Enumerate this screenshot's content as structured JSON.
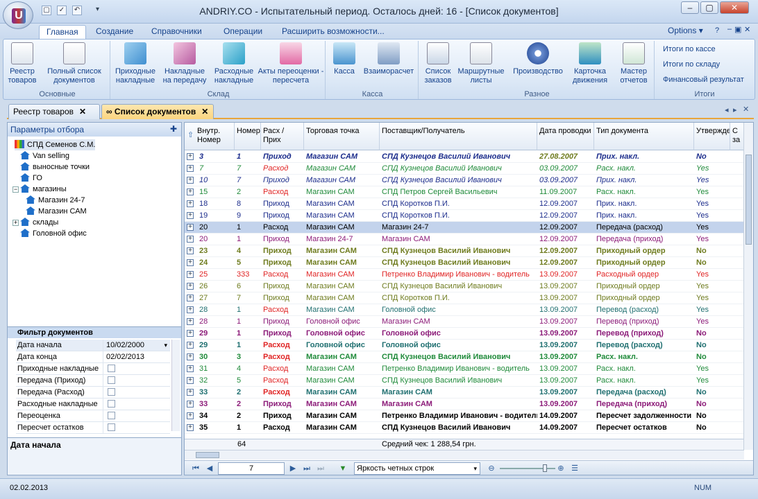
{
  "window": {
    "title": "ANDRIY.CO - Испытательный период. Осталось дней: 16 - [Список документов]"
  },
  "ribbon_tabs": [
    "Главная",
    "Создание",
    "Справочники",
    "Операции",
    "Расширить возможности..."
  ],
  "options_label": "Options",
  "groups": {
    "osnovnye": {
      "label": "Основные",
      "buttons": [
        "Реестр товаров",
        "Полный список документов"
      ]
    },
    "sklad": {
      "label": "Склад",
      "buttons": [
        "Приходные накладные",
        "Накладные на передачу",
        "Расходные накладные",
        "Акты переоценки - пересчета"
      ]
    },
    "kassa": {
      "label": "Касса",
      "buttons": [
        "Касса",
        "Взаиморасчет"
      ]
    },
    "raznoe": {
      "label": "Разное",
      "buttons": [
        "Список заказов",
        "Маршрутные листы",
        "Производство",
        "Карточка движения",
        "Мастер отчетов"
      ]
    },
    "itogi": {
      "label": "Итоги",
      "buttons": [
        "Итоги по кассе",
        "Итоги по складу",
        "Финансовый результат"
      ]
    }
  },
  "doc_tabs": [
    "Реестр товаров",
    "Список документов"
  ],
  "params": {
    "title": "Параметры отбора",
    "tree": [
      "СПД Семенов С.М.",
      "Van selling",
      "выносные точки",
      "ГО",
      "магазины",
      "Магазин 24-7",
      "Магазин САМ",
      "склады",
      "Головной офис"
    ]
  },
  "filter": {
    "title": "Фильтр документов",
    "rows": [
      {
        "label": "Дата начала",
        "value": "10/02/2000"
      },
      {
        "label": "Дата конца",
        "value": "02/02/2013"
      },
      {
        "label": "Приходные накладные",
        "value": ""
      },
      {
        "label": "Передача (Приход)",
        "value": ""
      },
      {
        "label": "Передача (Расход)",
        "value": ""
      },
      {
        "label": "Расходные накладные",
        "value": ""
      },
      {
        "label": "Переоценка",
        "value": ""
      },
      {
        "label": "Пересчет остатков",
        "value": ""
      }
    ],
    "description": "Дата начала"
  },
  "grid": {
    "columns": [
      "Внутр. Номер",
      "Номер",
      "Расх / Прих",
      "Торговая точка",
      "Поставщик/Получатель",
      "Дата проводки",
      "Тип документа",
      "Утверждено",
      "С за"
    ],
    "rows": [
      {
        "id": "3",
        "num": "1",
        "dir": "Приход",
        "point": "Магазин САМ",
        "party": "СПД Кузнецов Василий Иванович",
        "date": "27.08.2007",
        "type": "Прих. накл.",
        "approved": "No",
        "color": "c-navy",
        "style": "b i"
      },
      {
        "id": "7",
        "num": "7",
        "dir": "Расход",
        "point": "Магазин САМ",
        "party": "СПД Кузнецов Василий Иванович",
        "date": "03.09.2007",
        "type": "Расх. накл.",
        "approved": "Yes",
        "color": "c-green",
        "style": "i"
      },
      {
        "id": "10",
        "num": "7",
        "dir": "Приход",
        "point": "Магазин САМ",
        "party": "СПД Кузнецов Василий Иванович",
        "date": "03.09.2007",
        "type": "Прих. накл.",
        "approved": "Yes",
        "color": "c-navy",
        "style": "i"
      },
      {
        "id": "15",
        "num": "2",
        "dir": "Расход",
        "point": "Магазин САМ",
        "party": "СПД Петров Сергей Васильевич",
        "date": "11.09.2007",
        "type": "Расх. накл.",
        "approved": "Yes",
        "color": "c-green",
        "style": ""
      },
      {
        "id": "18",
        "num": "8",
        "dir": "Приход",
        "point": "Магазин САМ",
        "party": "СПД Коротков П.И.",
        "date": "12.09.2007",
        "type": "Прих. накл.",
        "approved": "Yes",
        "color": "c-navy",
        "style": ""
      },
      {
        "id": "19",
        "num": "9",
        "dir": "Приход",
        "point": "Магазин САМ",
        "party": "СПД Коротков П.И.",
        "date": "12.09.2007",
        "type": "Прих. накл.",
        "approved": "Yes",
        "color": "c-navy",
        "style": ""
      },
      {
        "id": "20",
        "num": "1",
        "dir": "Расход",
        "point": "Магазин САМ",
        "party": "Магазин 24-7",
        "date": "12.09.2007",
        "type": "Передача (расход)",
        "approved": "Yes",
        "color": "c-black",
        "style": ""
      },
      {
        "id": "20",
        "num": "1",
        "dir": "Приход",
        "point": "Магазин 24-7",
        "party": "Магазин САМ",
        "date": "12.09.2007",
        "type": "Передача (приход)",
        "approved": "Yes",
        "color": "c-purple",
        "style": ""
      },
      {
        "id": "23",
        "num": "4",
        "dir": "Приход",
        "point": "Магазин САМ",
        "party": "СПД Кузнецов Василий Иванович",
        "date": "12.09.2007",
        "type": "Приходный ордер",
        "approved": "No",
        "color": "c-olive",
        "style": "b"
      },
      {
        "id": "24",
        "num": "5",
        "dir": "Приход",
        "point": "Магазин САМ",
        "party": "СПД Кузнецов Василий Иванович",
        "date": "12.09.2007",
        "type": "Приходный ордер",
        "approved": "No",
        "color": "c-olive",
        "style": "b"
      },
      {
        "id": "25",
        "num": "333",
        "dir": "Расход",
        "point": "Магазин САМ",
        "party": "Петренко Владимир Иванович - водитель",
        "date": "13.09.2007",
        "type": "Расходный ордер",
        "approved": "Yes",
        "color": "c-red",
        "style": ""
      },
      {
        "id": "26",
        "num": "6",
        "dir": "Приход",
        "point": "Магазин САМ",
        "party": "СПД Кузнецов Василий Иванович",
        "date": "13.09.2007",
        "type": "Приходный ордер",
        "approved": "Yes",
        "color": "c-olive",
        "style": ""
      },
      {
        "id": "27",
        "num": "7",
        "dir": "Приход",
        "point": "Магазин САМ",
        "party": "СПД Коротков П.И.",
        "date": "13.09.2007",
        "type": "Приходный ордер",
        "approved": "Yes",
        "color": "c-olive",
        "style": ""
      },
      {
        "id": "28",
        "num": "1",
        "dir": "Расход",
        "point": "Магазин САМ",
        "party": "Головной офис",
        "date": "13.09.2007",
        "type": "Перевод (расход)",
        "approved": "Yes",
        "color": "c-teal",
        "style": ""
      },
      {
        "id": "28",
        "num": "1",
        "dir": "Приход",
        "point": "Головной офис",
        "party": "Магазин САМ",
        "date": "13.09.2007",
        "type": "Перевод (приход)",
        "approved": "Yes",
        "color": "c-purple",
        "style": ""
      },
      {
        "id": "29",
        "num": "1",
        "dir": "Приход",
        "point": "Головной офис",
        "party": "Головной офис",
        "date": "13.09.2007",
        "type": "Перевод (приход)",
        "approved": "No",
        "color": "c-purple",
        "style": "b"
      },
      {
        "id": "29",
        "num": "1",
        "dir": "Расход",
        "point": "Головной офис",
        "party": "Головной офис",
        "date": "13.09.2007",
        "type": "Перевод (расход)",
        "approved": "No",
        "color": "c-teal",
        "style": "b"
      },
      {
        "id": "30",
        "num": "3",
        "dir": "Расход",
        "point": "Магазин САМ",
        "party": "СПД Кузнецов Василий Иванович",
        "date": "13.09.2007",
        "type": "Расх. накл.",
        "approved": "No",
        "color": "c-green",
        "style": "b"
      },
      {
        "id": "31",
        "num": "4",
        "dir": "Расход",
        "point": "Магазин САМ",
        "party": "Петренко Владимир Иванович - водитель",
        "date": "13.09.2007",
        "type": "Расх. накл.",
        "approved": "Yes",
        "color": "c-green",
        "style": ""
      },
      {
        "id": "32",
        "num": "5",
        "dir": "Расход",
        "point": "Магазин САМ",
        "party": "СПД Кузнецов Василий Иванович",
        "date": "13.09.2007",
        "type": "Расх. накл.",
        "approved": "Yes",
        "color": "c-green",
        "style": ""
      },
      {
        "id": "33",
        "num": "2",
        "dir": "Расход",
        "point": "Магазин САМ",
        "party": "Магазин САМ",
        "date": "13.09.2007",
        "type": "Передача (расход)",
        "approved": "No",
        "color": "c-teal",
        "style": "b"
      },
      {
        "id": "33",
        "num": "2",
        "dir": "Приход",
        "point": "Магазин САМ",
        "party": "Магазин САМ",
        "date": "13.09.2007",
        "type": "Передача (приход)",
        "approved": "No",
        "color": "c-purple",
        "style": "b"
      },
      {
        "id": "34",
        "num": "2",
        "dir": "Приход",
        "point": "Магазин САМ",
        "party": "Петренко Владимир Иванович - водитель",
        "date": "14.09.2007",
        "type": "Пересчет задолженности",
        "approved": "No",
        "color": "c-black",
        "style": "b"
      },
      {
        "id": "35",
        "num": "1",
        "dir": "Расход",
        "point": "Магазин САМ",
        "party": "СПД Кузнецов Василий Иванович",
        "date": "14.09.2007",
        "type": "Пересчет остатков",
        "approved": "No",
        "color": "c-black",
        "style": "b"
      }
    ],
    "footer": {
      "count": "64",
      "avg": "Средний чек: 1 288,54 грн."
    }
  },
  "navbar": {
    "page": "7",
    "brightness": "Яркость четных строк"
  },
  "status": {
    "date": "02.02.2013",
    "num": "NUM"
  }
}
